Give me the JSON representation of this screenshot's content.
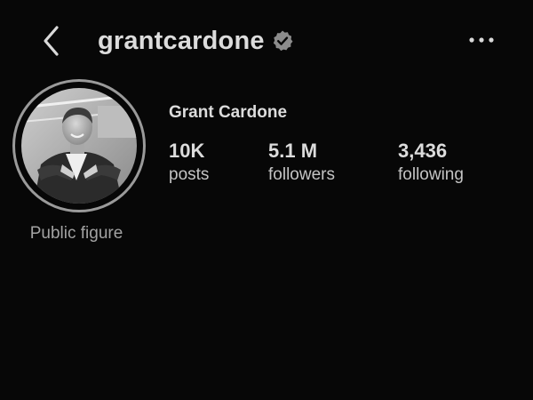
{
  "header": {
    "back_icon": "chevron-left-icon",
    "username": "grantcardone",
    "verified_icon": "verified-badge-icon",
    "more_icon": "more-horizontal-icon"
  },
  "profile": {
    "avatar_description_icon": "profile-photo",
    "category": "Public figure",
    "full_name": "Grant Cardone",
    "stats": {
      "posts": {
        "value": "10K",
        "label": "posts"
      },
      "followers": {
        "value": "5.1 M",
        "label": "followers"
      },
      "following": {
        "value": "3,436",
        "label": "following"
      }
    }
  },
  "colors": {
    "background": "#070707",
    "text_primary": "#dcdcdc",
    "text_secondary": "#a3a3a3",
    "avatar_ring": "#9a9a9a"
  }
}
